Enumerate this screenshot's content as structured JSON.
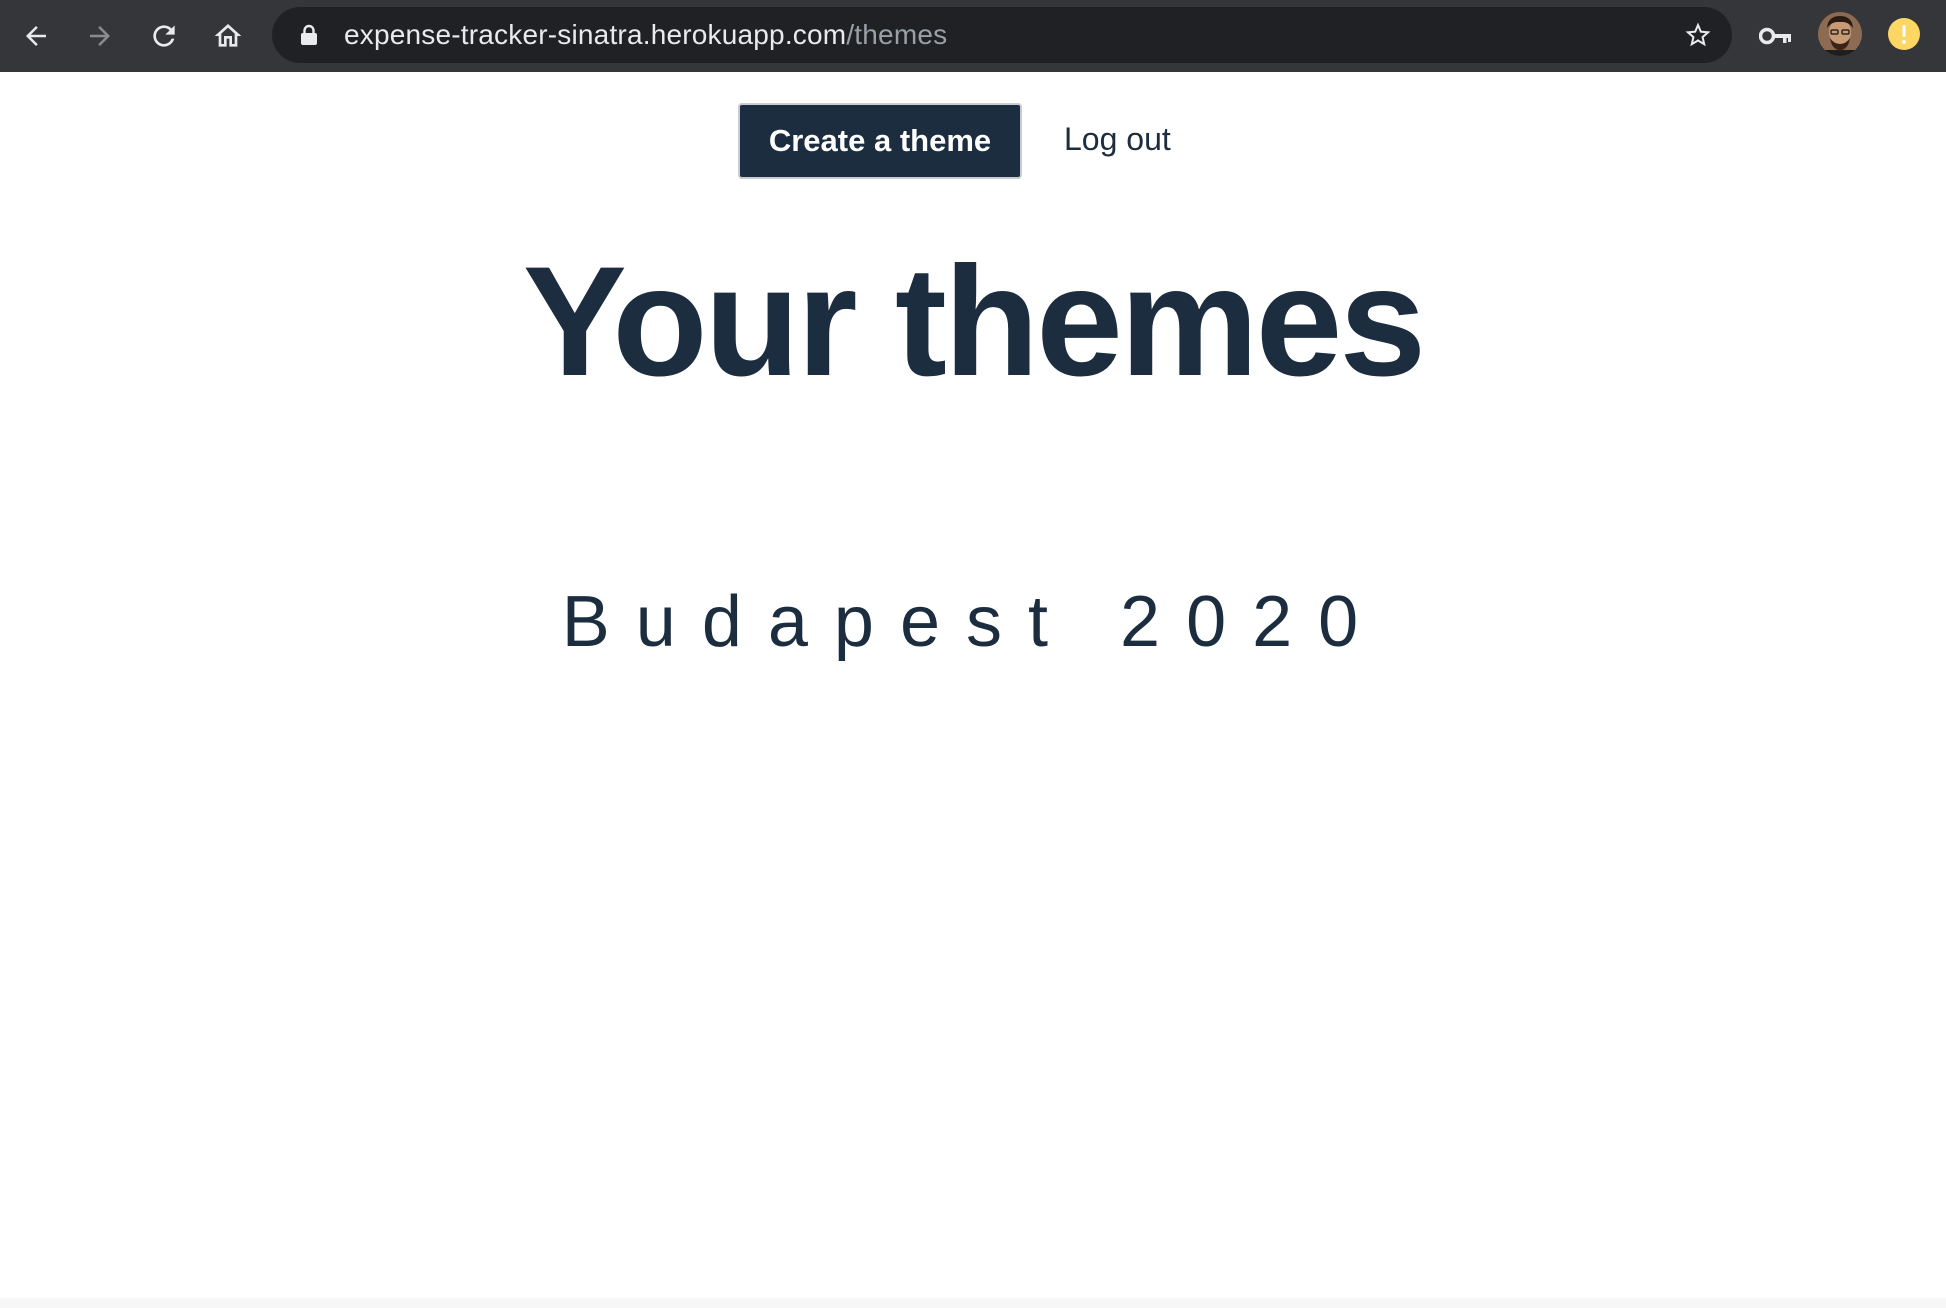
{
  "browser": {
    "url_host": "expense-tracker-sinatra.herokuapp.com",
    "url_path": "/themes",
    "icons": [
      "back-arrow-icon",
      "forward-arrow-icon",
      "reload-icon",
      "home-icon",
      "lock-icon",
      "star-icon",
      "key-icon",
      "avatar",
      "alert-icon"
    ],
    "alert_color": "#fdd663"
  },
  "nav": {
    "create_label": "Create a theme",
    "logout_label": "Log out"
  },
  "main": {
    "title": "Your themes",
    "themes": [
      {
        "name": "Budapest 2020"
      }
    ]
  },
  "colors": {
    "primary": "#1b2d3e",
    "chrome_bar": "#35363a",
    "omnibox": "#202124"
  }
}
